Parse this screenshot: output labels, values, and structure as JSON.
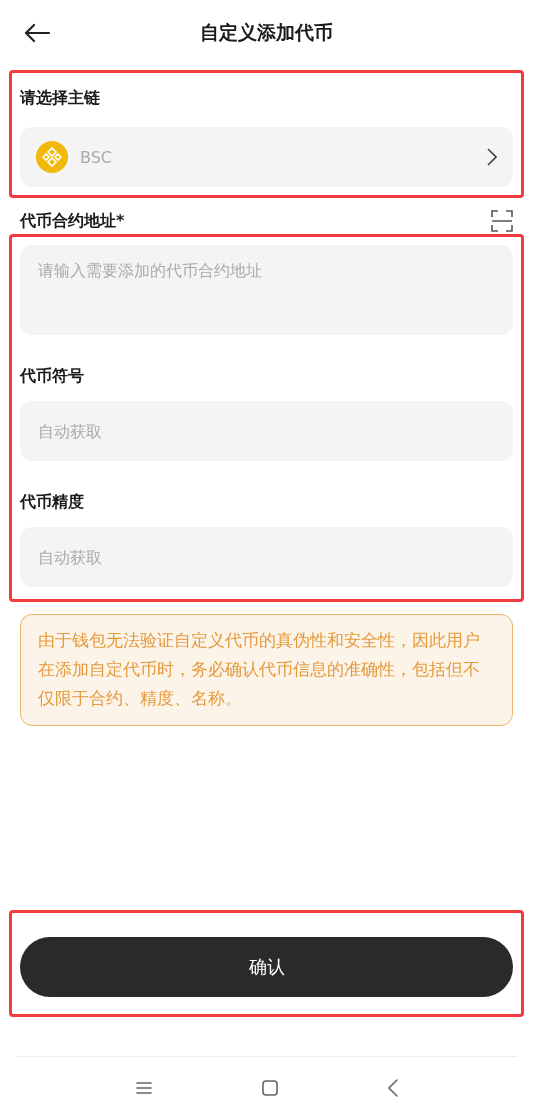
{
  "header": {
    "title": "自定义添加代币"
  },
  "chain": {
    "label": "请选择主链",
    "value": "BSC"
  },
  "contract": {
    "label": "代币合约地址*",
    "placeholder": "请输入需要添加的代币合约地址"
  },
  "symbol": {
    "label": "代币符号",
    "placeholder": "自动获取"
  },
  "precision": {
    "label": "代币精度",
    "placeholder": "自动获取"
  },
  "warning": "由于钱包无法验证自定义代币的真伪性和安全性，因此用户在添加自定代币时，务必确认代币信息的准确性，包括但不仅限于合约、精度、名称。",
  "confirm_button": "确认"
}
